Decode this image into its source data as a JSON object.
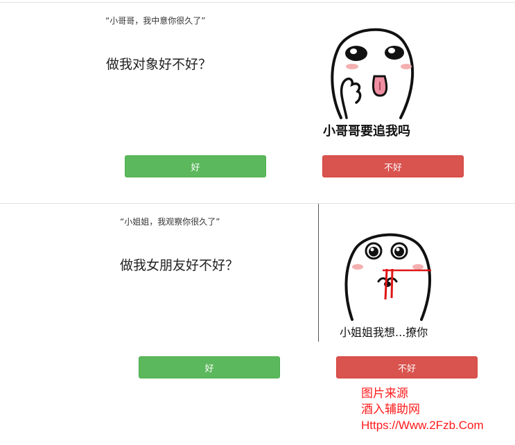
{
  "section1": {
    "quote": "“小哥哥，我中意你很久了”",
    "question": "做我对象好不好？",
    "meme_caption": "小哥哥要追我吗",
    "yes_label": "好",
    "no_label": "不好"
  },
  "section2": {
    "quote": "“小姐姐，我观察你很久了”",
    "question": "做我女朋友好不好？",
    "meme_caption": "小姐姐我想...撩你",
    "yes_label": "好",
    "no_label": "不好"
  },
  "watermark": {
    "line1": "图片来源",
    "line2": "酒入辅助网",
    "line3": "Https://Www.2Fzb.Com"
  },
  "colors": {
    "yes": "#5cb85c",
    "no": "#d9534f",
    "watermark": "#ff1a1a"
  }
}
